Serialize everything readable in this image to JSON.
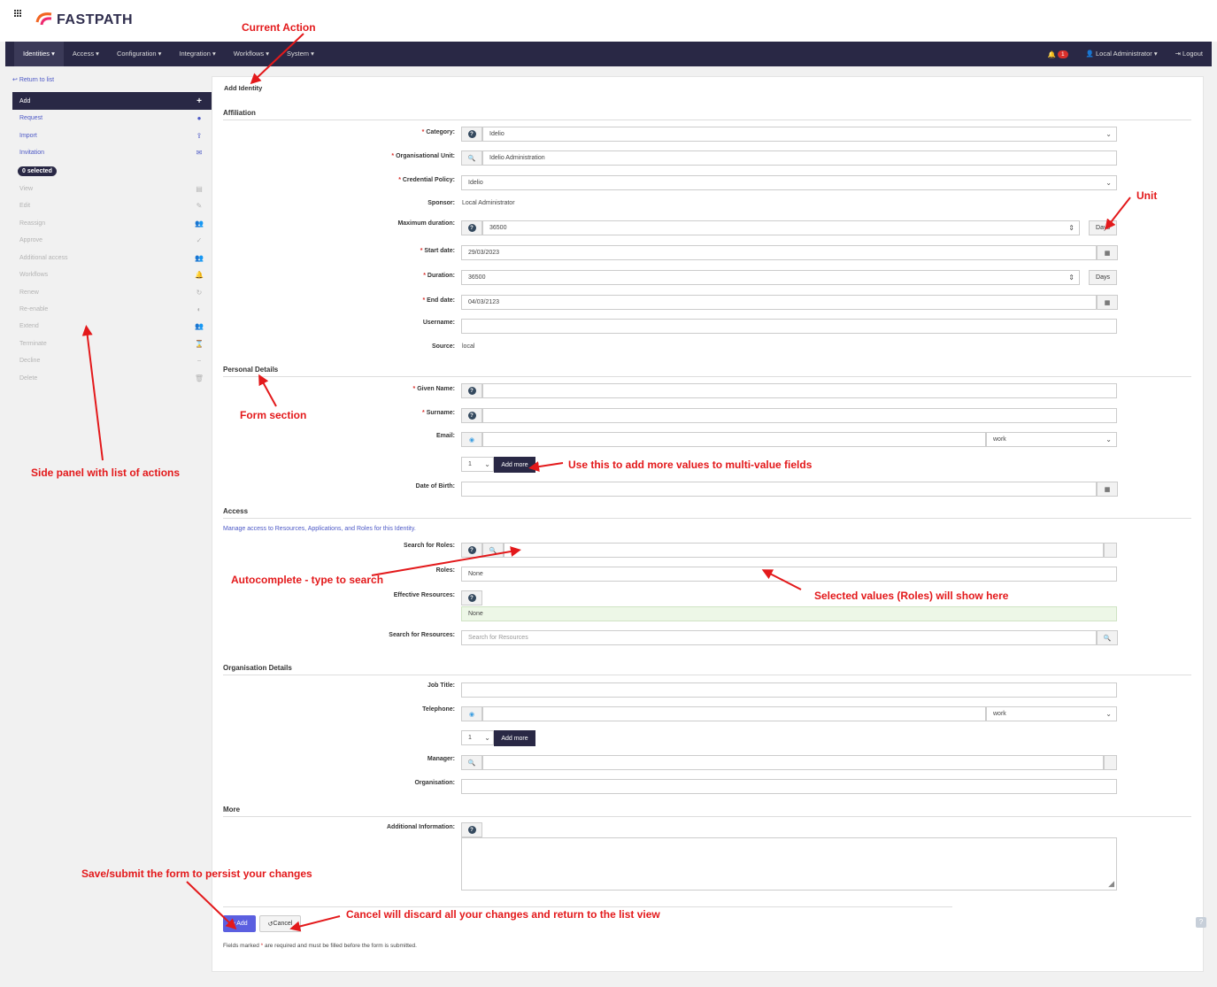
{
  "brand": {
    "name": "FASTPATH"
  },
  "nav": {
    "items": [
      "Identities",
      "Access",
      "Configuration",
      "Integration",
      "Workflows",
      "System"
    ],
    "notification_count": "1",
    "user": "Local Administrator",
    "logout": "Logout"
  },
  "sidebar": {
    "return": "Return to list",
    "actions": [
      {
        "label": "Add",
        "icon": "plus-icon"
      },
      {
        "label": "Request",
        "icon": "comment-icon"
      },
      {
        "label": "Import",
        "icon": "upload-icon"
      },
      {
        "label": "Invitation",
        "icon": "envelope-icon"
      }
    ],
    "selected_badge": "0 selected",
    "disabled_actions": [
      {
        "label": "View",
        "icon": "table-icon"
      },
      {
        "label": "Edit",
        "icon": "edit-icon"
      },
      {
        "label": "Reassign",
        "icon": "users-icon"
      },
      {
        "label": "Approve",
        "icon": "user-check-icon"
      },
      {
        "label": "Additional access",
        "icon": "users-icon"
      },
      {
        "label": "Workflows",
        "icon": "bell-icon"
      },
      {
        "label": "Renew",
        "icon": "refresh-icon"
      },
      {
        "label": "Re-enable",
        "icon": "toggle-icon"
      },
      {
        "label": "Extend",
        "icon": "users-icon"
      },
      {
        "label": "Terminate",
        "icon": "hourglass-icon"
      },
      {
        "label": "Decline",
        "icon": "user-minus-icon"
      },
      {
        "label": "Delete",
        "icon": "trash-icon"
      }
    ]
  },
  "form": {
    "title": "Add Identity",
    "sections": {
      "affiliation": "Affiliation",
      "personal": "Personal Details",
      "access": "Access",
      "org": "Organisation Details",
      "more": "More"
    },
    "category": {
      "label": "Category:",
      "value": "Idelio"
    },
    "org_unit": {
      "label": "Organisational Unit:",
      "value": "Idelio Administration"
    },
    "credential_policy": {
      "label": "Credential Policy:",
      "value": "Idelio"
    },
    "sponsor": {
      "label": "Sponsor:",
      "value": "Local Administrator"
    },
    "max_duration": {
      "label": "Maximum duration:",
      "value": "36500",
      "unit": "Days"
    },
    "start_date": {
      "label": "Start date:",
      "value": "29/03/2023"
    },
    "duration": {
      "label": "Duration:",
      "value": "36500",
      "unit": "Days"
    },
    "end_date": {
      "label": "End date:",
      "value": "04/03/2123"
    },
    "username": {
      "label": "Username:",
      "value": ""
    },
    "source": {
      "label": "Source:",
      "value": "local"
    },
    "given_name": {
      "label": "Given Name:"
    },
    "surname": {
      "label": "Surname:"
    },
    "email": {
      "label": "Email:",
      "type": "work",
      "count": "1",
      "add_more": "Add more"
    },
    "dob": {
      "label": "Date of Birth:"
    },
    "access_desc": "Manage access to Resources, Applications, and Roles for this Identity.",
    "search_roles": {
      "label": "Search for Roles:"
    },
    "roles": {
      "label": "Roles:",
      "value": "None"
    },
    "effective_resources": {
      "label": "Effective Resources:",
      "value": "None"
    },
    "search_resources": {
      "label": "Search for Resources:",
      "placeholder": "Search for Resources"
    },
    "job_title": {
      "label": "Job Title:"
    },
    "telephone": {
      "label": "Telephone:",
      "type": "work",
      "count": "1",
      "add_more": "Add more"
    },
    "manager": {
      "label": "Manager:"
    },
    "organisation": {
      "label": "Organisation:"
    },
    "additional_info": {
      "label": "Additional Information:"
    },
    "add_button": "Add",
    "cancel_button": "Cancel",
    "footnote_pre": "Fields marked",
    "footnote_post": "are required and must be filled before the form is submitted."
  },
  "annotations": {
    "current_action": "Current Action",
    "unit": "Unit",
    "form_section": "Form section",
    "side_panel": "Side panel with list of actions",
    "add_more": "Use this to add more values to multi-value fields",
    "autocomplete": "Autocomplete - type to search",
    "selected_values": "Selected values (Roles) will show here",
    "save": "Save/submit the form to persist your changes",
    "cancel": "Cancel will discard all your changes and return to the list view"
  },
  "colors": {
    "nav": "#292845",
    "accent": "#4d59c6",
    "annotation": "#e3191b",
    "required": "#d9302c"
  }
}
